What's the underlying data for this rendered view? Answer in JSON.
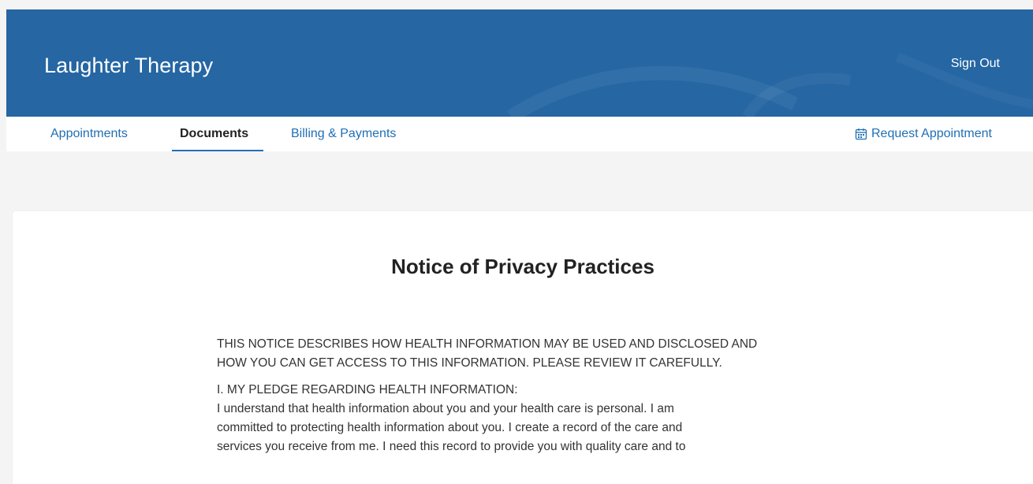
{
  "header": {
    "brand": "Laughter Therapy",
    "sign_out": "Sign Out",
    "accent_color": "#2566a3"
  },
  "nav": {
    "tabs": [
      {
        "label": "Appointments",
        "active": false
      },
      {
        "label": "Documents",
        "active": true
      },
      {
        "label": "Billing & Payments",
        "active": false
      }
    ],
    "request_appointment": {
      "label": "Request Appointment",
      "icon": "calendar-icon"
    },
    "link_color": "#1f6fb4"
  },
  "document": {
    "title": "Notice of Privacy Practices",
    "intro_line1": "THIS NOTICE DESCRIBES HOW HEALTH INFORMATION MAY BE USED AND DISCLOSED AND",
    "intro_line2": "HOW YOU CAN GET ACCESS TO THIS INFORMATION. PLEASE REVIEW IT CAREFULLY.",
    "section1_heading": "I. MY PLEDGE REGARDING HEALTH INFORMATION:",
    "section1_line1": "I understand that health information about you and your health care is personal. I am",
    "section1_line2": "committed to protecting health information about you. I create a record of the care and",
    "section1_line3": "services you receive from me. I need this record to provide you with quality care and to"
  }
}
